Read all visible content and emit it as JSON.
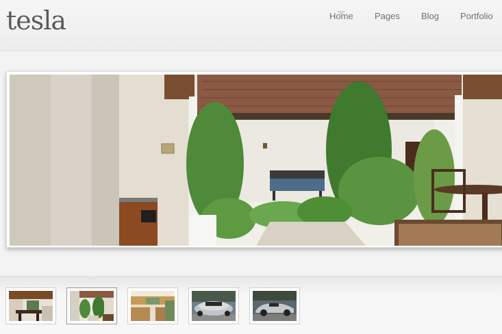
{
  "header": {
    "logo": "tesla",
    "nav": [
      {
        "label": "Home",
        "active": true
      },
      {
        "label": "Pages"
      },
      {
        "label": "Blog"
      },
      {
        "label": "Portfolio"
      }
    ]
  },
  "slider": {
    "active_index": 1,
    "slide_description": "courtyard"
  },
  "thumbnails": [
    {
      "subject": "dining room"
    },
    {
      "subject": "courtyard",
      "active": true
    },
    {
      "subject": "kitchen"
    },
    {
      "subject": "silver convertible car, front"
    },
    {
      "subject": "silver convertible car, side"
    }
  ],
  "colors": {
    "background": "#f3f3f3",
    "logo": "#5a5a5a",
    "nav_text": "#6c6c6c"
  }
}
